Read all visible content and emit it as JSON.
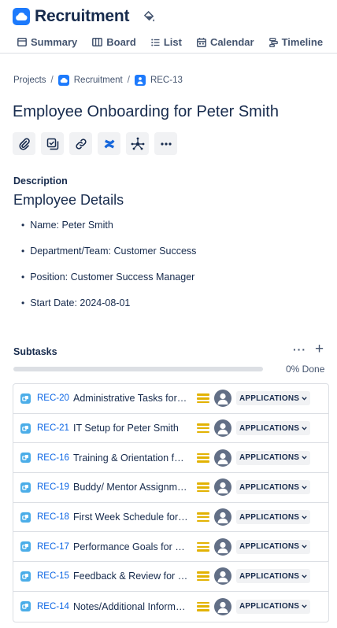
{
  "project": {
    "title": "Recruitment"
  },
  "tabs": [
    {
      "label": "Summary",
      "icon": "summary-icon"
    },
    {
      "label": "Board",
      "icon": "board-icon"
    },
    {
      "label": "List",
      "icon": "list-icon"
    },
    {
      "label": "Calendar",
      "icon": "calendar-icon"
    },
    {
      "label": "Timeline",
      "icon": "timeline-icon"
    }
  ],
  "breadcrumb": {
    "projects": "Projects",
    "project": "Recruitment",
    "issue": "REC-13"
  },
  "issue": {
    "title": "Employee Onboarding for Peter Smith"
  },
  "actions": [
    "paperclip-icon",
    "add-subtask-icon",
    "link-icon",
    "confluence-icon",
    "graph-icon",
    "more-icon"
  ],
  "description": {
    "label": "Description",
    "heading": "Employee Details",
    "items": [
      "Name: Peter Smith",
      "Department/Team: Customer Success",
      "Position: Customer Success Manager",
      "Start Date: 2024-08-01"
    ]
  },
  "subtasks": {
    "label": "Subtasks",
    "more": "···",
    "add": "+",
    "progress_label": "0% Done",
    "progress_fraction": 0,
    "items": [
      {
        "key": "REC-20",
        "summary": "Administrative Tasks for Peter Smith",
        "status": "APPLICATIONS"
      },
      {
        "key": "REC-21",
        "summary": "IT Setup for Peter Smith",
        "status": "APPLICATIONS"
      },
      {
        "key": "REC-16",
        "summary": "Training & Orientation for Peter Smith",
        "status": "APPLICATIONS"
      },
      {
        "key": "REC-19",
        "summary": "Buddy/ Mentor Assignment for Peter Smith",
        "status": "APPLICATIONS"
      },
      {
        "key": "REC-18",
        "summary": "First Week Schedule for Peter Smith",
        "status": "APPLICATIONS"
      },
      {
        "key": "REC-17",
        "summary": "Performance Goals for Peter Smith",
        "status": "APPLICATIONS"
      },
      {
        "key": "REC-15",
        "summary": "Feedback & Review for Peter Smith",
        "status": "APPLICATIONS"
      },
      {
        "key": "REC-14",
        "summary": "Notes/Additional Information for Peter Smith",
        "status": "APPLICATIONS"
      }
    ]
  },
  "colors": {
    "accent": "#1d7afc",
    "link": "#0c66e4",
    "priority_medium": "#e2b203",
    "subtask_type": "#4bade8",
    "text": "#172b4d"
  }
}
